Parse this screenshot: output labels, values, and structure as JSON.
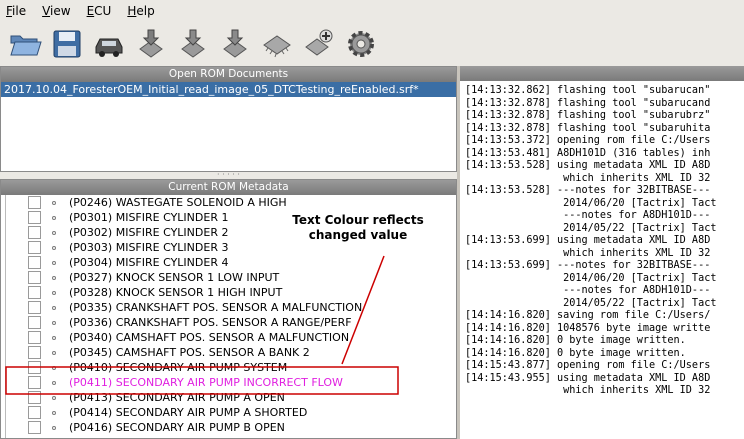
{
  "menu": [
    {
      "label": "File",
      "u": "F",
      "rest": "ile"
    },
    {
      "label": "View",
      "u": "V",
      "rest": "iew"
    },
    {
      "label": "ECU",
      "u": "E",
      "rest": "CU"
    },
    {
      "label": "Help",
      "u": "H",
      "rest": "elp"
    }
  ],
  "toolbar": {
    "icons": [
      "open-folder-icon",
      "save-disk-icon",
      "car-icon",
      "download-chip-icon",
      "read-chip-icon",
      "write-chip-icon",
      "chip-icon",
      "add-chip-icon",
      "settings-gear-icon"
    ]
  },
  "open_docs": {
    "header": "Open ROM Documents",
    "items": [
      "2017.10.04_ForesterOEM_Initial_read_image_05_DTCTesting_reEnabled.srf*"
    ]
  },
  "metadata": {
    "header": "Current ROM Metadata",
    "rows": [
      {
        "text": "(P0246) WASTEGATE SOLENOID A HIGH",
        "changed": false
      },
      {
        "text": "(P0301) MISFIRE CYLINDER 1",
        "changed": false
      },
      {
        "text": "(P0302) MISFIRE CYLINDER 2",
        "changed": false
      },
      {
        "text": "(P0303) MISFIRE CYLINDER 3",
        "changed": false
      },
      {
        "text": "(P0304) MISFIRE CYLINDER 4",
        "changed": false
      },
      {
        "text": "(P0327) KNOCK SENSOR 1 LOW INPUT",
        "changed": false
      },
      {
        "text": "(P0328) KNOCK SENSOR 1 HIGH INPUT",
        "changed": false
      },
      {
        "text": "(P0335) CRANKSHAFT POS. SENSOR A MALFUNCTION",
        "changed": false
      },
      {
        "text": "(P0336) CRANKSHAFT POS. SENSOR A RANGE/PERF",
        "changed": false
      },
      {
        "text": "(P0340) CAMSHAFT POS. SENSOR A MALFUNCTION",
        "changed": false
      },
      {
        "text": "(P0345) CAMSHAFT POS. SENSOR A BANK 2",
        "changed": false
      },
      {
        "text": "(P0410) SECONDARY AIR PUMP SYSTEM",
        "changed": false
      },
      {
        "text": "(P0411) SECONDARY AIR PUMP INCORRECT FLOW",
        "changed": true
      },
      {
        "text": "(P0413) SECONDARY AIR PUMP A OPEN",
        "changed": false
      },
      {
        "text": "(P0414) SECONDARY AIR PUMP A SHORTED",
        "changed": false
      },
      {
        "text": "(P0416) SECONDARY AIR PUMP B OPEN",
        "changed": false
      }
    ],
    "annotation": "Text Colour reflects changed value",
    "annotation_color": "#cc0000",
    "changed_color": "#e020e0"
  },
  "log": {
    "lines": [
      "[14:13:32.862] flashing tool \"subarucan\"",
      "[14:13:32.878] flashing tool \"subarucand",
      "[14:13:32.878] flashing tool \"subarubrz\"",
      "[14:13:32.878] flashing tool \"subaruhita",
      "[14:13:53.372] opening rom file C:/Users",
      "[14:13:53.481] A8DH101D (316 tables) inh",
      "[14:13:53.528] using metadata XML ID A8D",
      "                which inherits XML ID 32",
      "[14:13:53.528] ---notes for 32BITBASE---",
      "                2014/06/20 [Tactrix] Tact",
      "                ---notes for A8DH101D---",
      "                2014/05/22 [Tactrix] Tact",
      "[14:13:53.699] using metadata XML ID A8D",
      "                which inherits XML ID 32",
      "[14:13:53.699] ---notes for 32BITBASE---",
      "                2014/06/20 [Tactrix] Tact",
      "                ---notes for A8DH101D---",
      "                2014/05/22 [Tactrix] Tact",
      "[14:14:16.820] saving rom file C:/Users/",
      "[14:14:16.820] 1048576 byte image writte",
      "[14:14:16.820] 0 byte image written.",
      "[14:14:16.820] 0 byte image written.",
      "[14:15:43.877] opening rom file C:/Users",
      "[14:15:43.955] using metadata XML ID A8D",
      "                which inherits XML ID 32"
    ]
  }
}
